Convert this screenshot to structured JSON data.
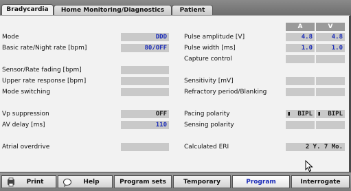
{
  "tabs": [
    "Bradycardia",
    "Home Monitoring/Diagnostics",
    "Patient"
  ],
  "left": [
    {
      "label": "Mode",
      "value": "DDD",
      "blue": true
    },
    {
      "label": "Basic rate/Night rate [bpm]",
      "value": "80/OFF",
      "blue": true
    },
    {
      "label": "Sensor/Rate fading  [bpm]",
      "value": ""
    },
    {
      "label": "Upper rate response [bpm]",
      "value": ""
    },
    {
      "label": "Mode switching",
      "value": ""
    },
    {
      "label": "Vp suppression",
      "value": "OFF",
      "blue": false
    },
    {
      "label": "AV delay [ms]",
      "value": "110",
      "blue": true
    },
    {
      "label": "Atrial overdrive",
      "value": ""
    }
  ],
  "columns": [
    "A",
    "V"
  ],
  "right": [
    {
      "label": "Pulse amplitude  [V]",
      "a": "4.8",
      "v": "4.8"
    },
    {
      "label": "Pulse width [ms]",
      "a": "1.0",
      "v": "1.0"
    },
    {
      "label": "Capture control",
      "a": "",
      "v": ""
    },
    {
      "label": "Sensitivity [mV]",
      "a": "",
      "v": ""
    },
    {
      "label": "Refractory period/Blanking",
      "a": "",
      "v": ""
    },
    {
      "label": "Pacing polarity",
      "a": "BIPL",
      "v": "BIPL"
    },
    {
      "label": "Sensing polarity",
      "a": "",
      "v": ""
    },
    {
      "label": "Calculated ERI",
      "span": "2 Y. 7 Mo."
    }
  ],
  "footer": {
    "print": "Print",
    "help": "Help",
    "program_sets": "Program sets",
    "temporary": "Temporary",
    "program": "Program",
    "interrogate": "Interrogate"
  },
  "colors": {
    "value_blue": "#1a2bb8",
    "field_gray": "#c9c9c9",
    "header_gray": "#9a9a9a"
  }
}
